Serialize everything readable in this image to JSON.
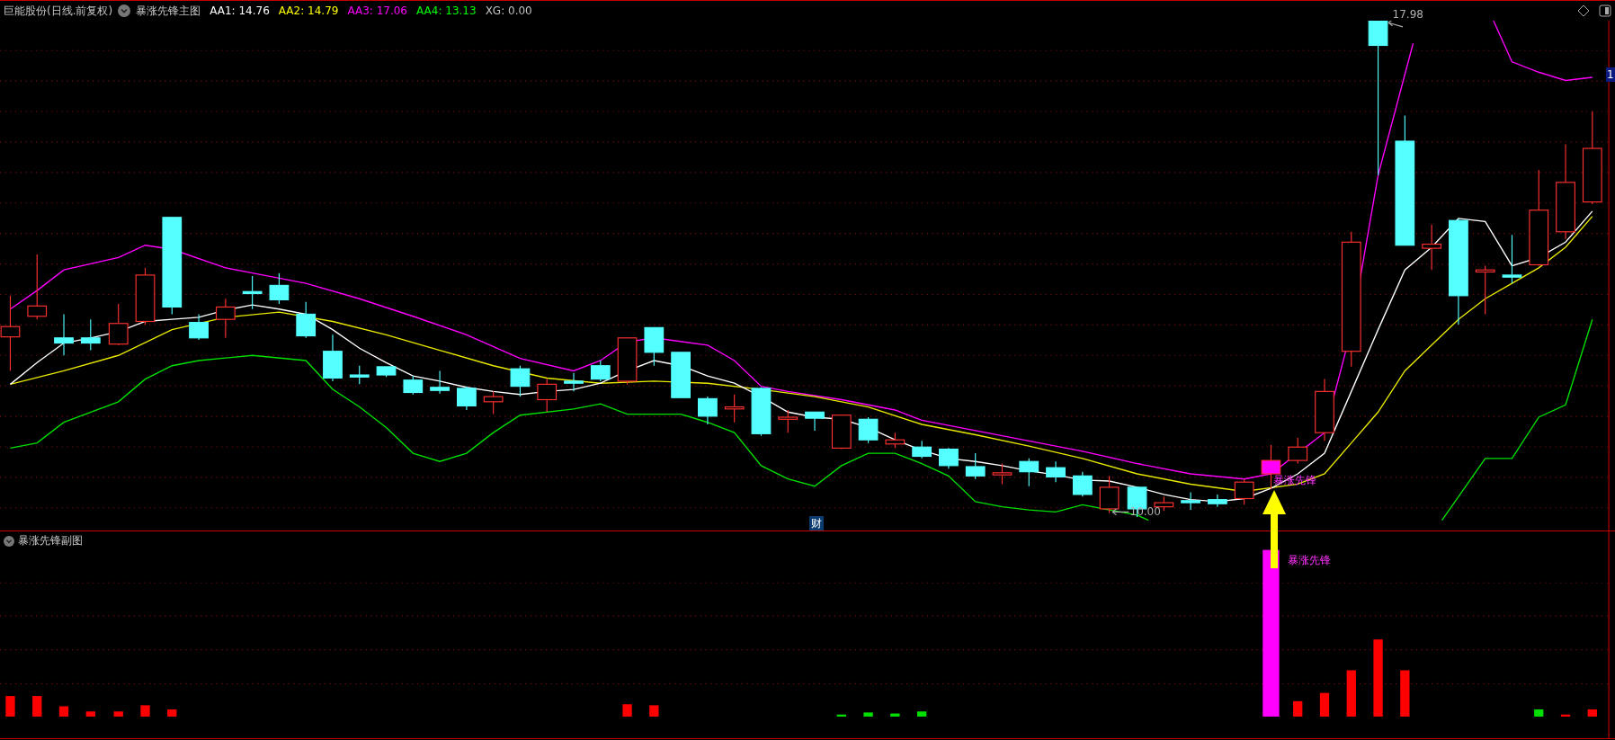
{
  "header": {
    "stock_title": "巨能股份(日线.前复权)",
    "indicator_name": "暴涨先锋主图",
    "legend": [
      {
        "label": "AA1: 14.76",
        "color": "#ffffff"
      },
      {
        "label": "AA2: 14.79",
        "color": "#ffff00"
      },
      {
        "label": "AA3: 17.06",
        "color": "#ff00ff"
      },
      {
        "label": "AA4: 13.13",
        "color": "#00ff00"
      },
      {
        "label": "XG: 0.00",
        "color": "#c0c0c0"
      }
    ]
  },
  "main_chart": {
    "annotations": [
      {
        "kind": "price",
        "text": "17.98"
      },
      {
        "kind": "price",
        "text": "10.00"
      },
      {
        "kind": "signal",
        "text": "暴涨先锋"
      },
      {
        "kind": "badge",
        "text": "财"
      }
    ],
    "axis_label": "1"
  },
  "sub_chart": {
    "title": "暴涨先锋副图",
    "signal_label": "暴涨先锋"
  }
}
